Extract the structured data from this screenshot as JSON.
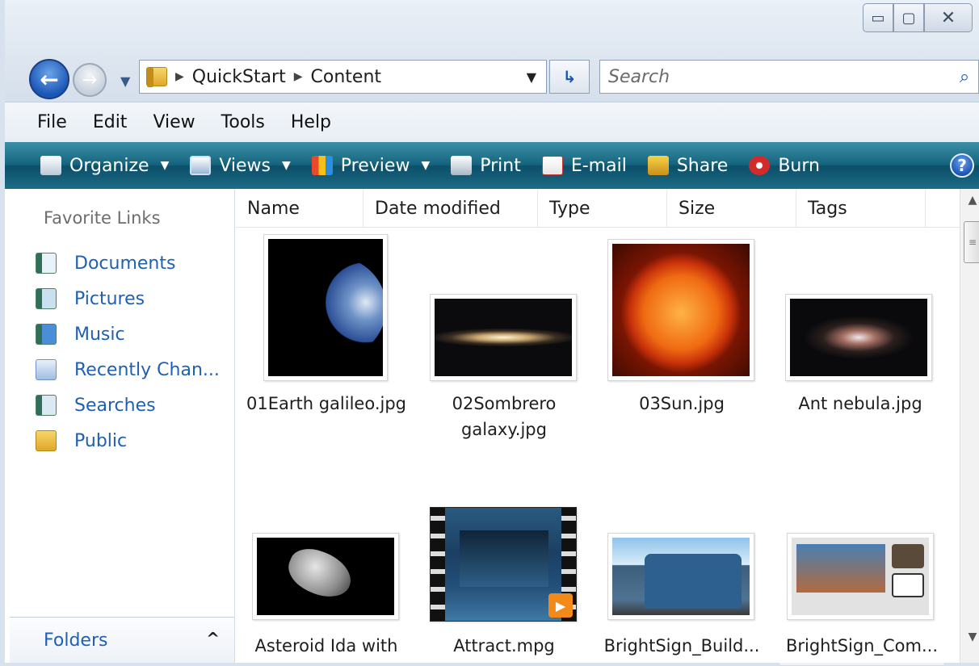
{
  "window": {
    "minimize": "▭",
    "maximize": "▢",
    "close": "✕"
  },
  "address": {
    "crumbs": [
      "QuickStart",
      "Content"
    ],
    "search_placeholder": "Search"
  },
  "menu": [
    "File",
    "Edit",
    "View",
    "Tools",
    "Help"
  ],
  "toolbar": {
    "organize": "Organize",
    "views": "Views",
    "preview": "Preview",
    "print": "Print",
    "email": "E-mail",
    "share": "Share",
    "burn": "Burn"
  },
  "nav": {
    "heading": "Favorite Links",
    "items": [
      "Documents",
      "Pictures",
      "Music",
      "Recently Chan...",
      "Searches",
      "Public"
    ],
    "folders": "Folders"
  },
  "columns": [
    "Name",
    "Date modified",
    "Type",
    "Size",
    "Tags"
  ],
  "files": [
    {
      "line1": "01Earth galileo.jpg",
      "line2": ""
    },
    {
      "line1": "02Sombrero",
      "line2": "galaxy.jpg"
    },
    {
      "line1": "03Sun.jpg",
      "line2": ""
    },
    {
      "line1": "Ant nebula.jpg",
      "line2": ""
    },
    {
      "line1": "Asteroid Ida with",
      "line2": ""
    },
    {
      "line1": "Attract.mpg",
      "line2": ""
    },
    {
      "line1": "BrightSign_Build...",
      "line2": ""
    },
    {
      "line1": "BrightSign_Com...",
      "line2": ""
    }
  ],
  "colors": {
    "link": "#1f5fb4",
    "command_bar": "#14647f"
  }
}
